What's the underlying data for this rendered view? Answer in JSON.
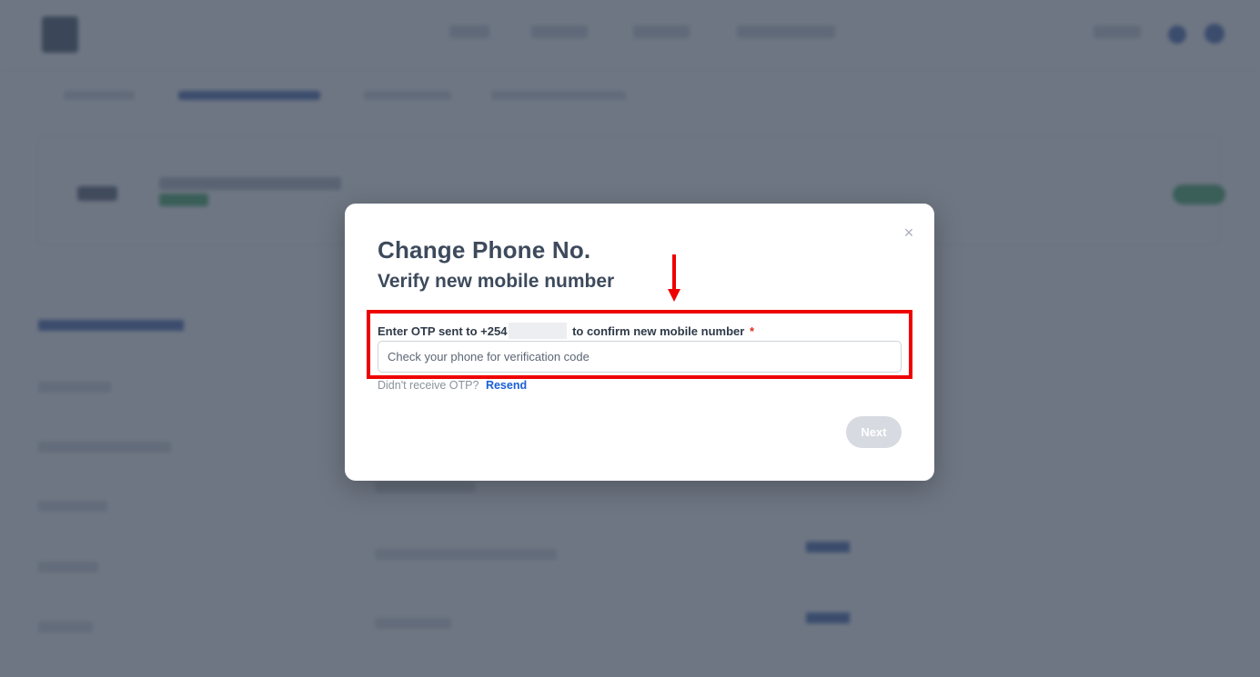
{
  "modal": {
    "title": "Change Phone No.",
    "subtitle": "Verify new mobile number",
    "close_icon": "×",
    "otp_label_prefix": "Enter OTP sent to +254",
    "otp_label_suffix": " to confirm new mobile number",
    "required_marker": "*",
    "otp_placeholder": "Check your phone for verification code",
    "resend_prompt": "Didn't receive OTP?",
    "resend_link": "Resend",
    "next_button": "Next"
  },
  "colors": {
    "highlight": "#ee0000",
    "link": "#1a5fd6",
    "overlay": "rgba(60,70,88,0.74)"
  }
}
